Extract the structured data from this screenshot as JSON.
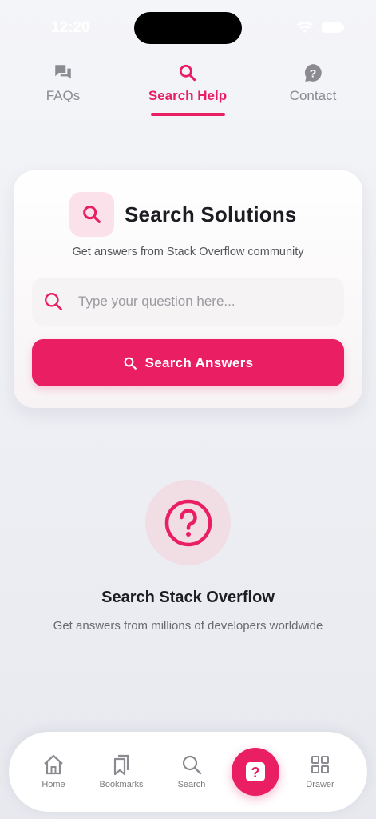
{
  "status_bar": {
    "time": "12:20"
  },
  "tabs": [
    {
      "label": "FAQs",
      "icon": "forum-icon",
      "active": false
    },
    {
      "label": "Search Help",
      "icon": "search-icon",
      "active": true
    },
    {
      "label": "Contact",
      "icon": "help-circle-icon",
      "active": false
    }
  ],
  "search_card": {
    "title": "Search Solutions",
    "subtitle": "Get answers from Stack Overflow community",
    "input_value": "",
    "input_placeholder": "Type your question here...",
    "button_label": "Search Answers"
  },
  "empty_state": {
    "title": "Search Stack Overflow",
    "subtitle": "Get answers from millions of developers worldwide",
    "icon": "question-circle-icon"
  },
  "bottom_nav": {
    "items": [
      {
        "label": "Home",
        "icon": "home-icon"
      },
      {
        "label": "Bookmarks",
        "icon": "bookmarks-icon"
      },
      {
        "label": "Search",
        "icon": "search-icon"
      },
      {
        "label": "",
        "icon": "help-square-icon",
        "active": true
      },
      {
        "label": "Drawer",
        "icon": "grid-icon"
      }
    ]
  },
  "colors": {
    "accent": "#e91e63",
    "accent_light": "#fbe1ea",
    "text": "#1c1c22",
    "muted": "#8a8a90"
  }
}
